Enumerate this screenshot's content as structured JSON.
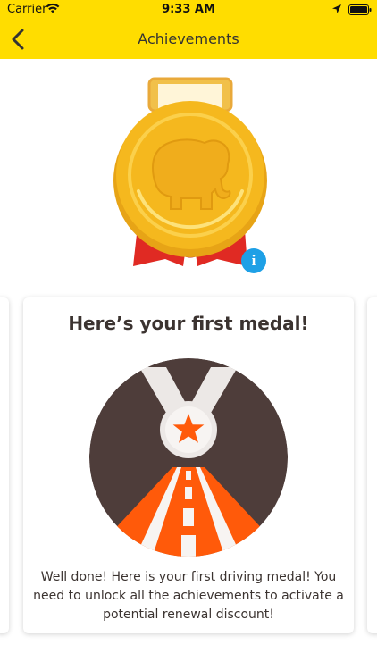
{
  "status_bar": {
    "carrier": "Carrier",
    "time": "9:33 AM",
    "icons": [
      "wifi-icon",
      "location-arrow-icon",
      "battery-icon"
    ]
  },
  "nav": {
    "back_icon": "chevron-left-icon",
    "title": "Achievements"
  },
  "medal": {
    "icon": "gold-elephant-medal",
    "info_label": "i"
  },
  "card": {
    "heading": "Here’s your first medal!",
    "badge_icon": "road-star-badge",
    "message": "Well done! Here is your first driving medal! You need to unlock all the achievements to activate a potential renewal discount!"
  },
  "colors": {
    "nav_bar": "#ffdd00",
    "medal_gold": "#f5b81e",
    "ribbon_red": "#e02a23",
    "info_blue": "#1ea0e6",
    "badge_brown": "#4e3d3a",
    "badge_orange": "#ff5a0a"
  }
}
